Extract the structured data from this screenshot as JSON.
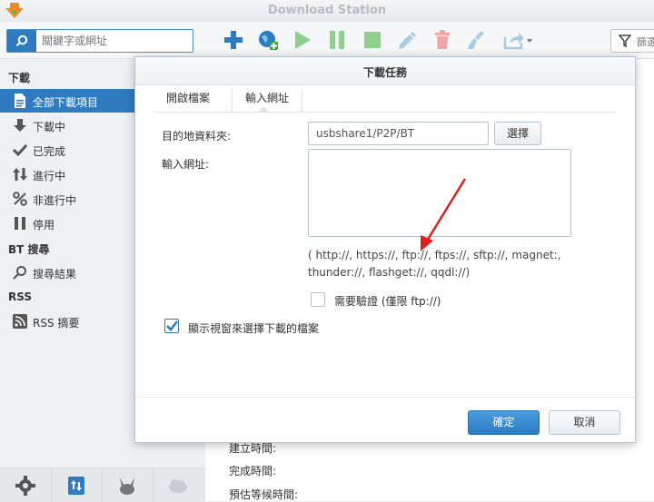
{
  "app": {
    "title": "Download Station"
  },
  "search": {
    "placeholder": "關鍵字或網址"
  },
  "filter": {
    "label": "篩選"
  },
  "sidebar": {
    "sections": [
      {
        "label": "下載",
        "items": [
          "全部下載項目",
          "下載中",
          "已完成",
          "進行中",
          "非進行中",
          "停用"
        ]
      },
      {
        "label": "BT 搜尋",
        "items": [
          "搜尋結果"
        ]
      },
      {
        "label": "RSS",
        "items": [
          "RSS 摘要"
        ]
      }
    ]
  },
  "details": [
    "建立時間:",
    "完成時間:",
    "預估等候時間:"
  ],
  "dialog": {
    "title": "下載任務",
    "tabs": [
      "開啟檔案",
      "輸入網址"
    ],
    "active_tab": 1,
    "destination_label": "目的地資料夾:",
    "destination_value": "usbshare1/P2P/BT",
    "browse_label": "選擇",
    "url_label": "輸入網址:",
    "url_value": "",
    "protocols_hint_line1": "( http://, https://, ftp://, ftps://, sftp://, magnet:,",
    "protocols_hint_line2": "thunder://, flashget://, qqdl://)",
    "auth_label": "需要驗證 (僅限 ftp://)",
    "auth_checked": false,
    "show_window_label": "顯示視窗來選擇下載的檔案",
    "show_window_checked": true,
    "ok_label": "確定",
    "cancel_label": "取消"
  },
  "colors": {
    "accent": "#2e7bc0",
    "annotation_arrow": "#e02020"
  }
}
